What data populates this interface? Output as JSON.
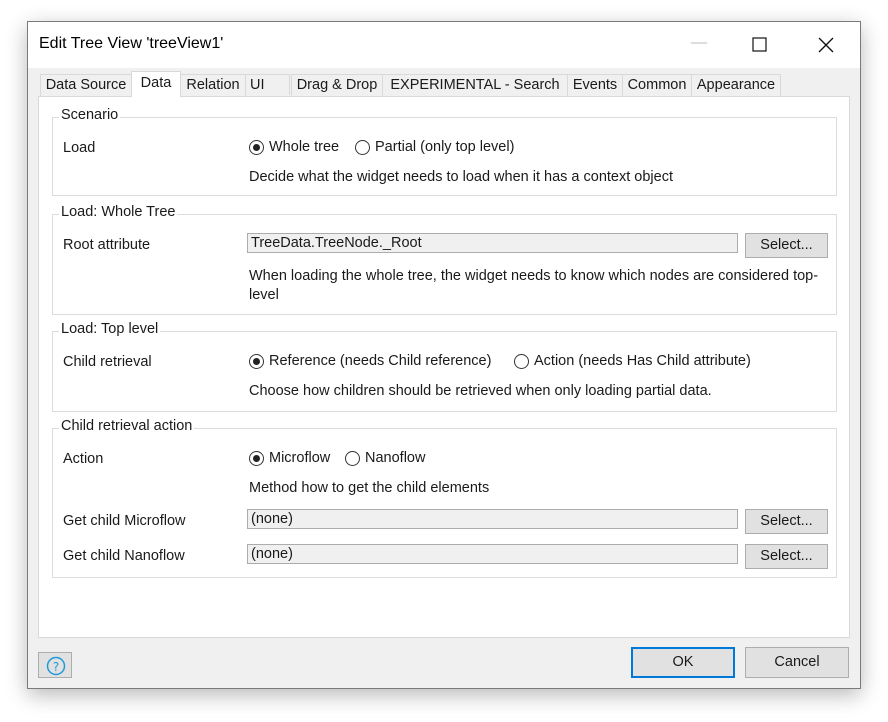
{
  "window": {
    "title": "Edit Tree View 'treeView1'"
  },
  "tabs": [
    {
      "label": "Data Source"
    },
    {
      "label": "Data"
    },
    {
      "label": "Relation"
    },
    {
      "label": "UI"
    },
    {
      "label": "Drag & Drop"
    },
    {
      "label": "EXPERIMENTAL - Search"
    },
    {
      "label": "Events"
    },
    {
      "label": "Common"
    },
    {
      "label": "Appearance"
    }
  ],
  "active_tab": "Data",
  "scenario": {
    "title": "Scenario",
    "load_label": "Load",
    "options": [
      "Whole tree",
      "Partial (only top level)"
    ],
    "selected": "Whole tree",
    "description": "Decide what the widget needs to load when it has a context object"
  },
  "whole_tree": {
    "title": "Load: Whole Tree",
    "root_label": "Root attribute",
    "root_value": "TreeData.TreeNode._Root",
    "select_label": "Select...",
    "description": "When loading the whole tree, the widget needs to know which nodes are considered top-level"
  },
  "top_level": {
    "title": "Load: Top level",
    "child_label": "Child retrieval",
    "options": [
      "Reference (needs Child reference)",
      "Action (needs Has Child attribute)"
    ],
    "selected": "Reference (needs Child reference)",
    "description": "Choose how children should be retrieved when only loading partial data."
  },
  "child_action": {
    "title": "Child retrieval action",
    "action_label": "Action",
    "options": [
      "Microflow",
      "Nanoflow"
    ],
    "selected": "Microflow",
    "description": "Method how to get the child elements",
    "microflow_label": "Get child Microflow",
    "microflow_value": "(none)",
    "nanoflow_label": "Get child Nanoflow",
    "nanoflow_value": "(none)",
    "select_label": "Select..."
  },
  "footer": {
    "ok": "OK",
    "cancel": "Cancel"
  },
  "colors": {
    "accent": "#0078d7",
    "help_icon": "#1e9bd7"
  },
  "icons": [
    "minimize-icon",
    "maximize-icon",
    "close-icon",
    "help-icon"
  ]
}
